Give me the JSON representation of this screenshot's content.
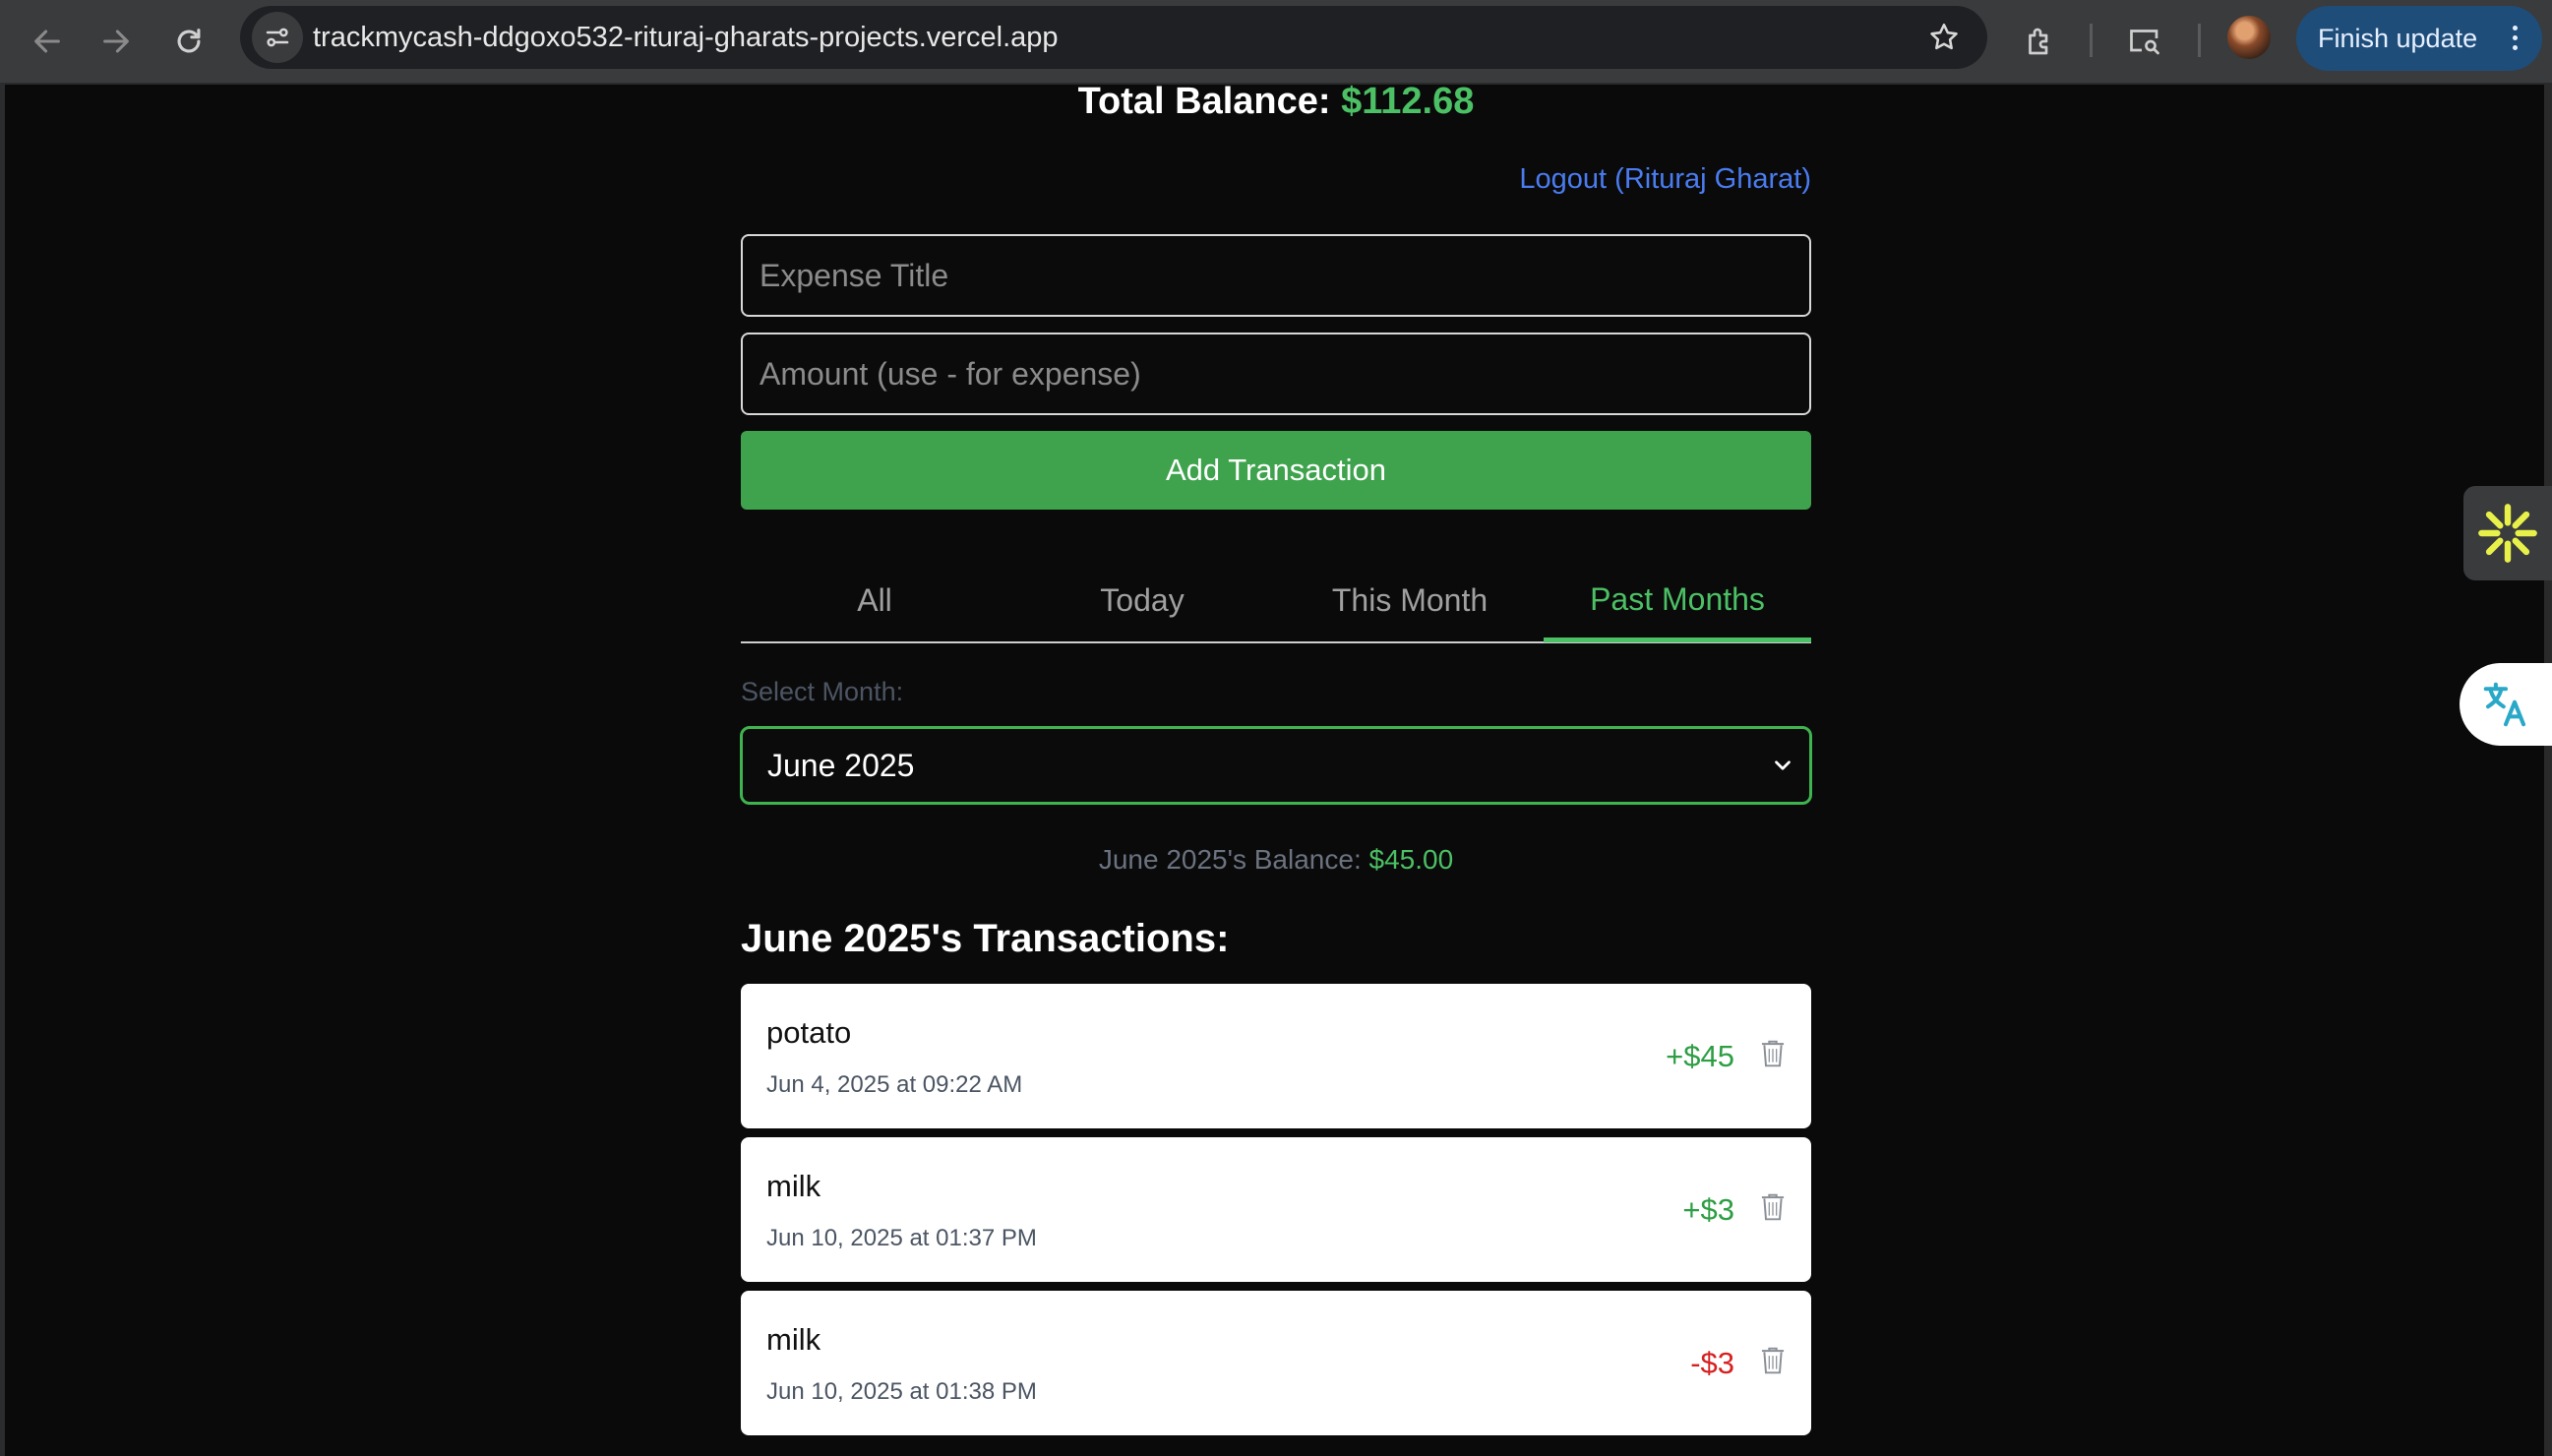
{
  "browser": {
    "url": "trackmycash-ddgoxo532-rituraj-gharats-projects.vercel.app",
    "finish_update_label": "Finish update"
  },
  "header": {
    "balance_label": "Total Balance:",
    "balance_value": "$112.68",
    "logout_label": "Logout (Rituraj Gharat)"
  },
  "form": {
    "title_placeholder": "Expense Title",
    "amount_placeholder": "Amount (use - for expense)",
    "add_label": "Add Transaction"
  },
  "tabs": [
    {
      "label": "All",
      "active": false
    },
    {
      "label": "Today",
      "active": false
    },
    {
      "label": "This Month",
      "active": false
    },
    {
      "label": "Past Months",
      "active": true
    }
  ],
  "filter": {
    "select_label": "Select Month:",
    "selected_month": "June 2025",
    "month_balance_label": "June 2025's Balance:",
    "month_balance_value": "$45.00"
  },
  "transactions_heading": "June 2025's Transactions:",
  "transactions": [
    {
      "title": "potato",
      "date": "Jun 4, 2025 at 09:22 AM",
      "amount": "+$45",
      "sign": "positive"
    },
    {
      "title": "milk",
      "date": "Jun 10, 2025 at 01:37 PM",
      "amount": "+$3",
      "sign": "positive"
    },
    {
      "title": "milk",
      "date": "Jun 10, 2025 at 01:38 PM",
      "amount": "-$3",
      "sign": "negative"
    }
  ],
  "colors": {
    "accent_green": "#4cc065",
    "button_green": "#3fa34d",
    "negative_red": "#d72020",
    "link_blue": "#4a7cf0",
    "background": "#0a0a0a"
  }
}
